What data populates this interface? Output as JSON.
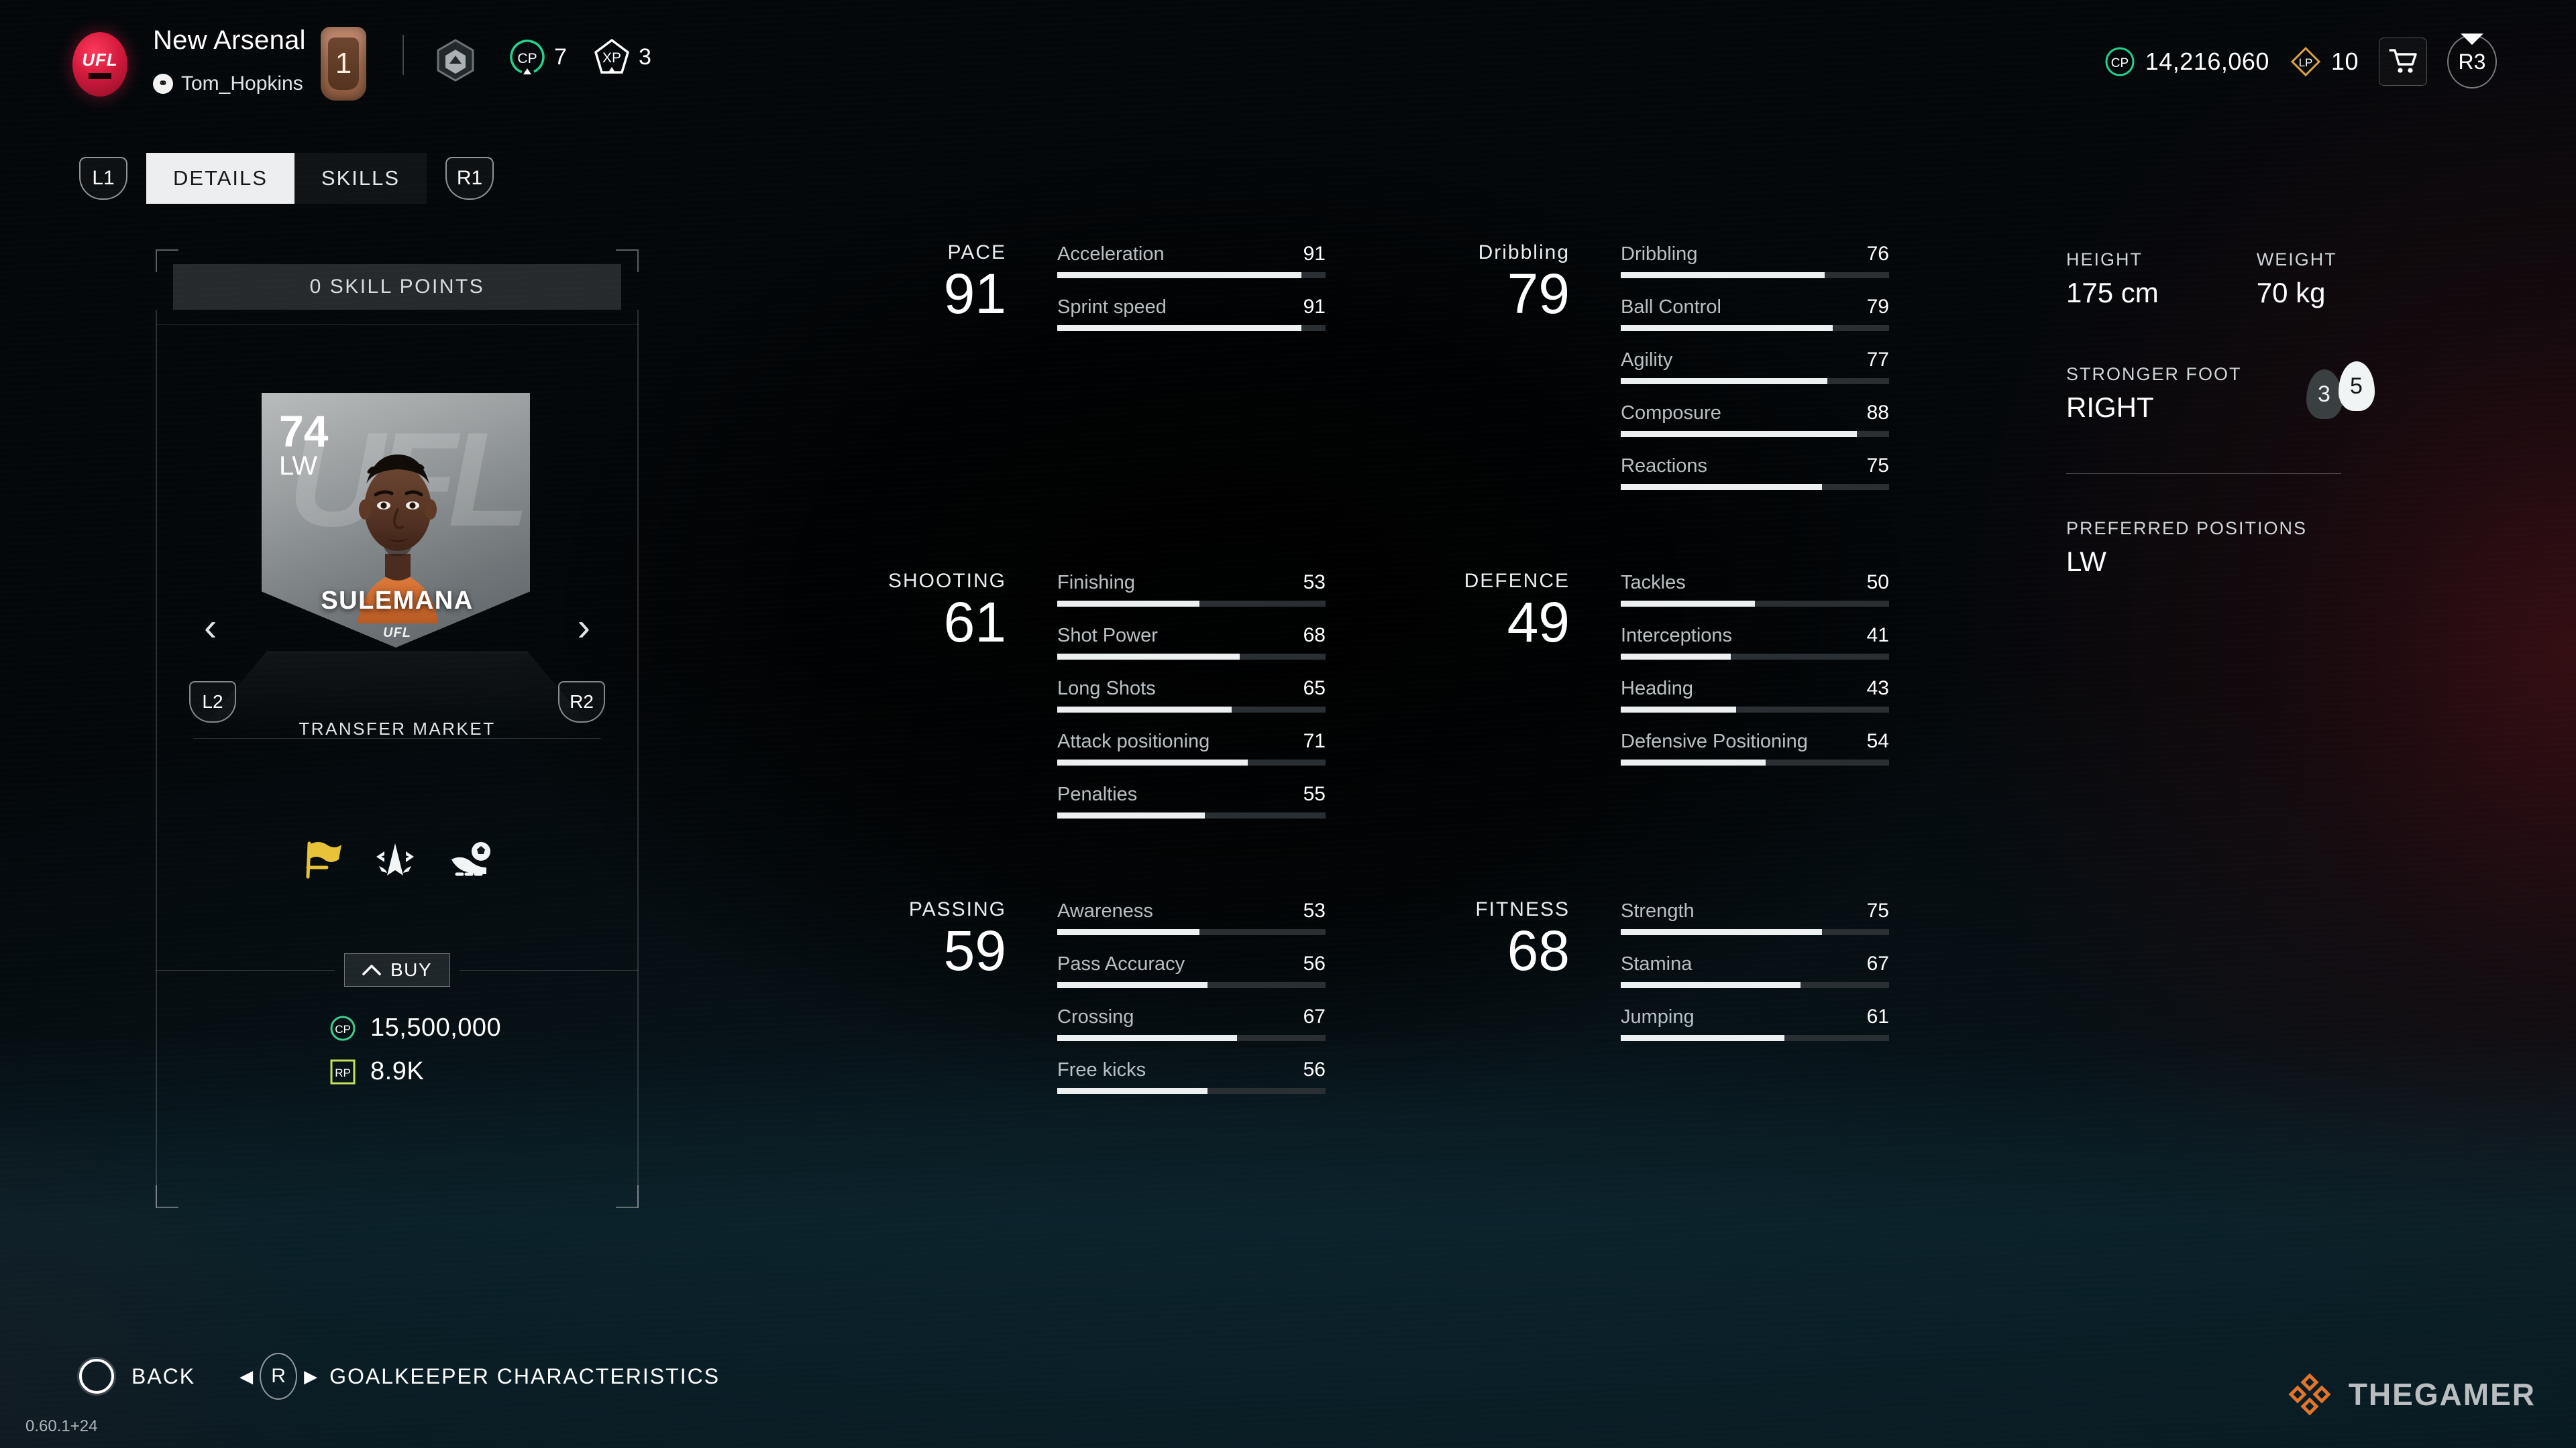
{
  "header": {
    "club_badge_label": "UFL",
    "team_name": "New Arsenal",
    "platform_icon": "playstation-icon",
    "user_name": "Tom_Hopkins",
    "level": "1",
    "boost_icon": "hexagon-boost-icon",
    "cp_chip_label": "CP",
    "cp_chip_value": "7",
    "xp_chip_label": "XP",
    "xp_chip_value": "3",
    "wallet_cp_label": "CP",
    "wallet_cp_value": "14,216,060",
    "wallet_lp_label": "LP",
    "wallet_lp_value": "10",
    "cart_icon": "shopping-cart-icon",
    "r3_label": "R3"
  },
  "tabs": {
    "left_bumper": "L1",
    "right_bumper": "R1",
    "items": [
      {
        "label": "DETAILS",
        "active": true
      },
      {
        "label": "SKILLS",
        "active": false
      }
    ]
  },
  "card_panel": {
    "skill_points": "0 SKILL POINTS",
    "rating": "74",
    "position": "LW",
    "player_name": "SULEMANA",
    "brand": "UFL",
    "watermark_text": "UFL",
    "prev_arrow": "‹",
    "next_arrow": "›",
    "left_trigger": "L2",
    "right_trigger": "R2",
    "transfer_market": "TRANSFER MARKET",
    "traits": [
      {
        "name": "captain-flag-icon",
        "color": "#e8c33a"
      },
      {
        "name": "agility-dribbler-icon",
        "color": "#f2f5f6"
      },
      {
        "name": "finisher-boot-ball-icon",
        "color": "#f2f5f6"
      }
    ],
    "buy_label": "BUY",
    "prices": [
      {
        "currency": "CP",
        "value": "15,500,000",
        "color": "#3ecf8e"
      },
      {
        "currency": "RP",
        "value": "8.9K",
        "color": "#c5e05a"
      }
    ]
  },
  "stats": {
    "groups": [
      {
        "name": "PACE",
        "value": "91",
        "column": 0,
        "rows": [
          {
            "label": "Acceleration",
            "value": 91
          },
          {
            "label": "Sprint speed",
            "value": 91
          }
        ]
      },
      {
        "name": "Dribbling",
        "value": "79",
        "column": 1,
        "rows": [
          {
            "label": "Dribbling",
            "value": 76
          },
          {
            "label": "Ball Control",
            "value": 79
          },
          {
            "label": "Agility",
            "value": 77
          },
          {
            "label": "Composure",
            "value": 88
          },
          {
            "label": "Reactions",
            "value": 75
          }
        ]
      },
      {
        "name": "SHOOTING",
        "value": "61",
        "column": 0,
        "rows": [
          {
            "label": "Finishing",
            "value": 53
          },
          {
            "label": "Shot Power",
            "value": 68
          },
          {
            "label": "Long Shots",
            "value": 65
          },
          {
            "label": "Attack positioning",
            "value": 71
          },
          {
            "label": "Penalties",
            "value": 55
          }
        ]
      },
      {
        "name": "DEFENCE",
        "value": "49",
        "column": 1,
        "rows": [
          {
            "label": "Tackles",
            "value": 50
          },
          {
            "label": "Interceptions",
            "value": 41
          },
          {
            "label": "Heading",
            "value": 43
          },
          {
            "label": "Defensive Positioning",
            "value": 54
          }
        ]
      },
      {
        "name": "PASSING",
        "value": "59",
        "column": 0,
        "rows": [
          {
            "label": "Awareness",
            "value": 53
          },
          {
            "label": "Pass Accuracy",
            "value": 56
          },
          {
            "label": "Crossing",
            "value": 67
          },
          {
            "label": "Free kicks",
            "value": 56
          }
        ]
      },
      {
        "name": "FITNESS",
        "value": "68",
        "column": 1,
        "rows": [
          {
            "label": "Strength",
            "value": 75
          },
          {
            "label": "Stamina",
            "value": 67
          },
          {
            "label": "Jumping",
            "value": 61
          }
        ]
      }
    ]
  },
  "info": {
    "height_label": "HEIGHT",
    "height_value": "175 cm",
    "weight_label": "WEIGHT",
    "weight_value": "70 kg",
    "stronger_foot_label": "STRONGER FOOT",
    "stronger_foot_value": "RIGHT",
    "weak_foot_rating": "3",
    "strong_foot_rating": "5",
    "preferred_positions_label": "PREFERRED POSITIONS",
    "preferred_positions_value": "LW"
  },
  "bottom": {
    "back_label": "BACK",
    "back_button_icon": "circle-button-icon",
    "stick_label": "R",
    "left_arrow": "◀",
    "right_arrow": "▶",
    "gk_label": "GOALKEEPER CHARACTERISTICS",
    "version": "0.60.1+24"
  },
  "watermark": {
    "text": "THEGAMER",
    "logo_color": "#e2752a"
  }
}
